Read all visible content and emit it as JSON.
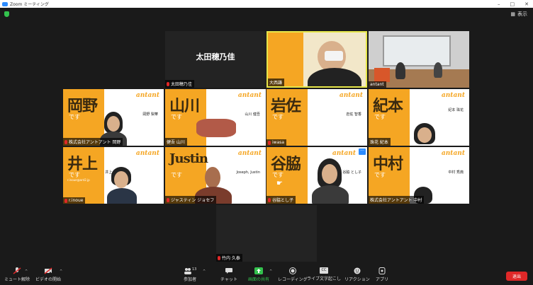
{
  "window": {
    "title": "Zoom ミーティング",
    "min": "–",
    "max": "□",
    "close": "✕"
  },
  "view_button": "表示",
  "colors": {
    "accent": "#2d8cff",
    "orange": "#f5a623",
    "end": "#e02828",
    "green": "#33c24d"
  },
  "tiles": [
    {
      "id": "t1",
      "label": "太田穂乃佳",
      "center_text": "太田穂乃佳",
      "muted": true
    },
    {
      "id": "t2",
      "label": "大西謙",
      "muted": false
    },
    {
      "id": "t3",
      "label": "antant",
      "muted": false
    },
    {
      "id": "t4",
      "label": "株式会社アントアント 岡野",
      "big": "岡野",
      "desu": "です",
      "card_name": "岡野 梨華",
      "muted": true
    },
    {
      "id": "t5",
      "label": "健吾 山川",
      "big": "山川",
      "desu": "です",
      "card_name": "山川 健吾",
      "muted": false
    },
    {
      "id": "t6",
      "label": "iwasa",
      "big": "岩佐",
      "desu": "です",
      "card_name": "岩佐 智香",
      "muted": true
    },
    {
      "id": "t7",
      "label": "珠花 紀本",
      "big": "紀本",
      "desu": "です",
      "card_name": "紀本 珠花",
      "muted": false
    },
    {
      "id": "t8",
      "label": "r.inoue",
      "big": "井上",
      "desu": "です",
      "card_name": "井上 遼",
      "email": "r.inoue@ant2.jp",
      "muted": true
    },
    {
      "id": "t9",
      "label": "ジャスティン ジョセフ",
      "big": "Justin",
      "desu": "です",
      "card_name": "Joseph, Justin",
      "muted": true
    },
    {
      "id": "t10",
      "label": "谷脇とし子",
      "big": "谷脇",
      "desu": "です",
      "card_name": "谷脇 とし子",
      "muted": true
    },
    {
      "id": "t11",
      "label": "株式会社アントアント 中村",
      "big": "中村",
      "desu": "です",
      "card_name": "中村 秀典",
      "muted": false
    },
    {
      "id": "t12",
      "label": "竹内 久泰",
      "muted": true
    }
  ],
  "logo": "antant",
  "toolbar": {
    "mute": "ミュート解除",
    "video": "ビデオの開始",
    "participants": "参加者",
    "participant_count": "13",
    "chat": "チャット",
    "share": "画面の共有",
    "record": "レコーディング",
    "captions": "ライブ文字起こし",
    "reactions": "リアクション",
    "apps": "アプリ",
    "end": "退出",
    "cc": "CC"
  }
}
